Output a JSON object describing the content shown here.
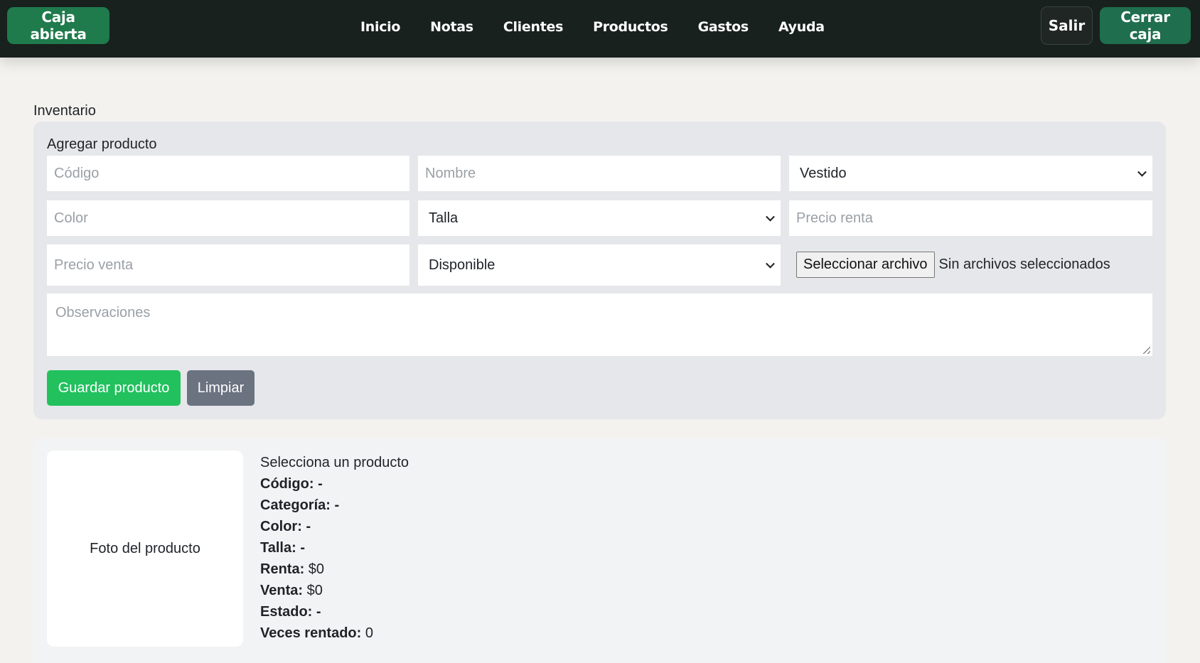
{
  "topbar": {
    "status_button": "Caja abierta",
    "nav": [
      "Inicio",
      "Notas",
      "Clientes",
      "Productos",
      "Gastos",
      "Ayuda"
    ],
    "logout_button": "Salir",
    "close_register_button": "Cerrar caja"
  },
  "section_title": "Inventario",
  "add_product": {
    "title": "Agregar producto",
    "code_placeholder": "Código",
    "name_placeholder": "Nombre",
    "category_selected": "Vestido",
    "color_placeholder": "Color",
    "size_selected": "Talla",
    "rent_price_placeholder": "Precio renta",
    "sale_price_placeholder": "Precio venta",
    "status_selected": "Disponible",
    "file_button": "Seleccionar archivo",
    "file_status": "Sin archivos seleccionados",
    "notes_placeholder": "Observaciones",
    "save_button": "Guardar producto",
    "clear_button": "Limpiar"
  },
  "detail": {
    "photo_label": "Foto del producto",
    "heading": "Selecciona un producto",
    "rows": [
      {
        "label": "Código:",
        "value": " -"
      },
      {
        "label": "Categoría:",
        "value": " -"
      },
      {
        "label": "Color:",
        "value": " -"
      },
      {
        "label": "Talla:",
        "value": " -"
      },
      {
        "label": "Renta:",
        "value": " $0"
      },
      {
        "label": "Venta:",
        "value": " $0"
      },
      {
        "label": "Estado:",
        "value": " -"
      },
      {
        "label": "Veces rentado:",
        "value": " 0"
      }
    ]
  }
}
